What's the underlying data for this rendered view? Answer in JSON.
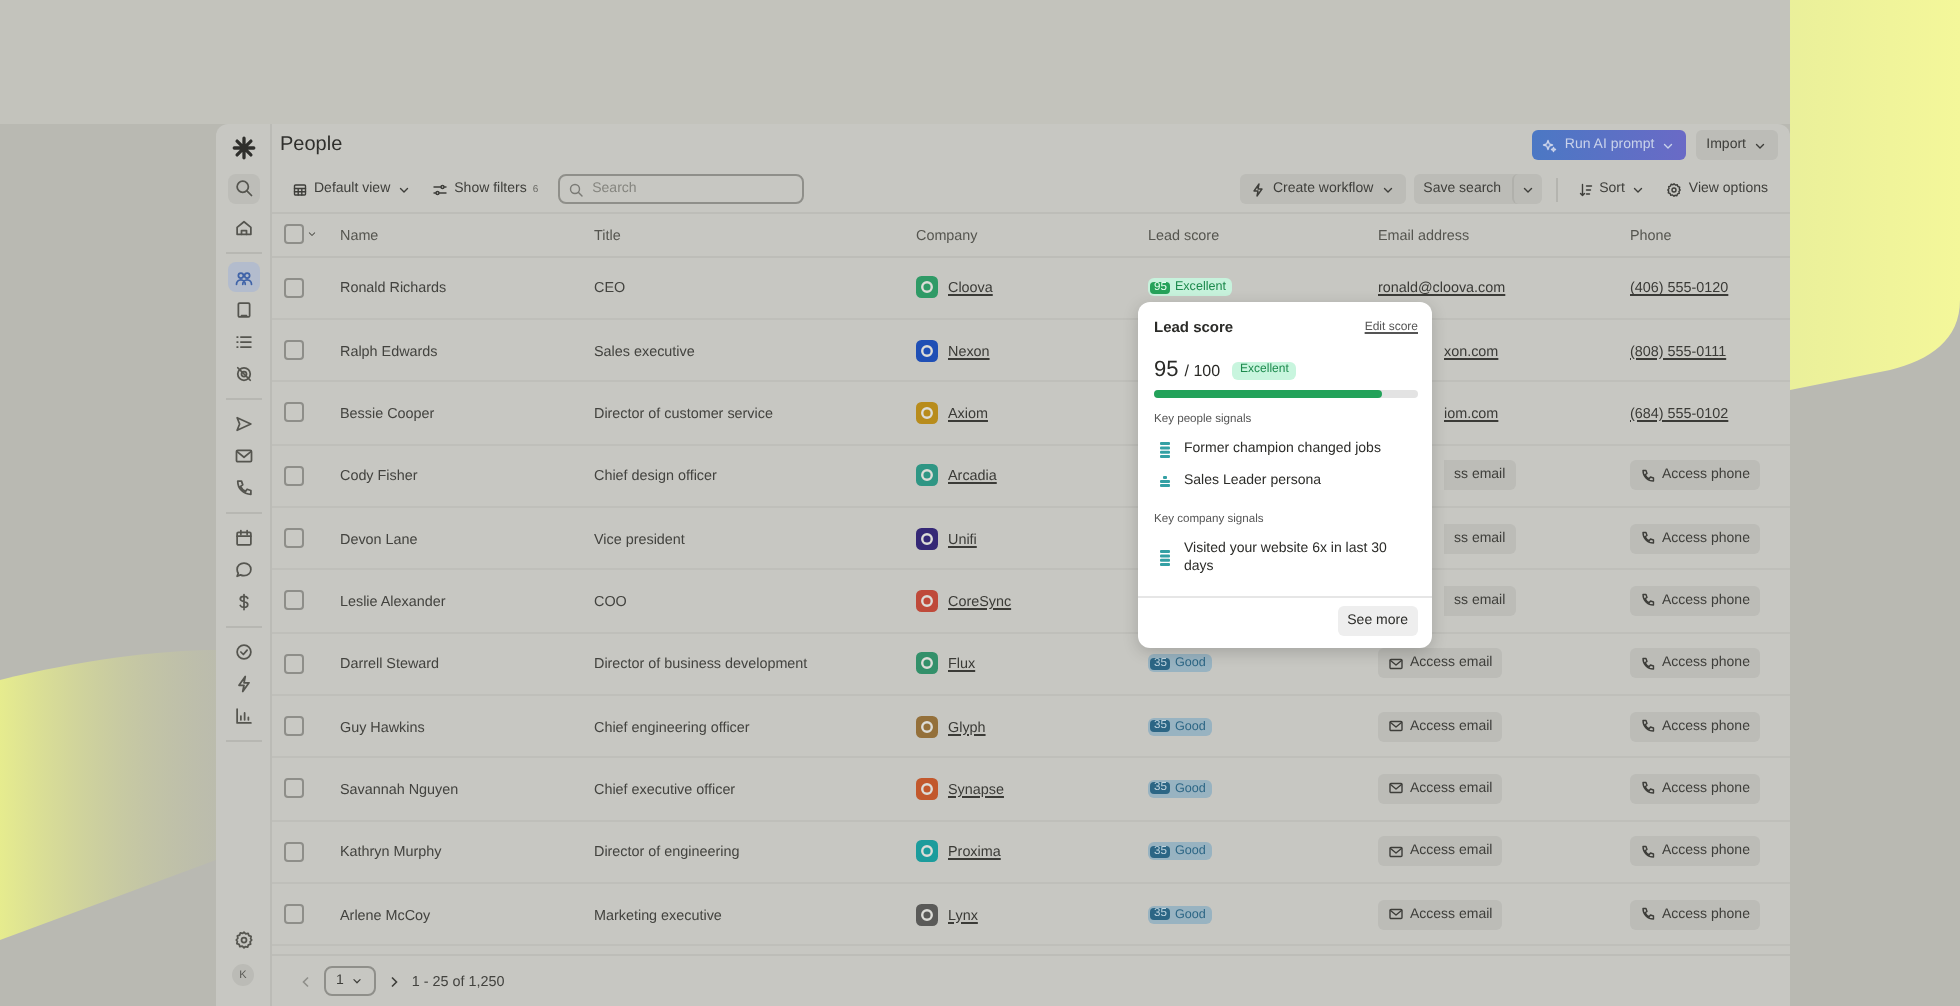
{
  "app": {
    "avatar": "K"
  },
  "sidebar": {
    "items": [
      {
        "selected": false
      },
      {
        "selected": false
      },
      {
        "selected": true
      },
      {
        "selected": false
      },
      {
        "selected": false
      },
      {
        "selected": false
      },
      {
        "selected": false
      },
      {
        "selected": false
      },
      {
        "selected": false
      },
      {
        "selected": false
      },
      {
        "selected": false
      },
      {
        "selected": false
      },
      {
        "selected": false
      },
      {
        "selected": false
      },
      {
        "selected": false
      },
      {
        "selected": false
      }
    ]
  },
  "header": {
    "title": "People",
    "buttons": [
      {
        "label": "Run AI prompt",
        "kind": "primary"
      },
      {
        "label": "Import",
        "kind": "secondary"
      }
    ]
  },
  "toolbar": {
    "view": "Default view",
    "filters": {
      "label": "Show filters",
      "count": "6"
    },
    "search": {
      "placeholder": "Search"
    },
    "workflow": "Create workflow",
    "save": "Save search",
    "sort": "Sort",
    "options": "View options"
  },
  "table": {
    "select_all": {
      "checked": false
    },
    "columns": [
      "Name",
      "Title",
      "Company",
      "Lead score",
      "Email address",
      "Phone"
    ],
    "rows": [
      {
        "selected": false,
        "name": "Ronald Richards",
        "title": "CEO",
        "company": {
          "name": "Cloova",
          "color": "#2f9a66"
        },
        "lead_score": {
          "score": "95",
          "label": "Excellent",
          "kind": "excellent"
        },
        "email": {
          "kind": "link",
          "text": "ronald@cloova.com"
        },
        "phone": {
          "kind": "link",
          "text": "(406) 555-0120"
        }
      },
      {
        "selected": false,
        "name": "Ralph Edwards",
        "title": "Sales executive",
        "company": {
          "name": "Nexon",
          "color": "#1f4fb5"
        },
        "email": {
          "kind": "link",
          "text": "xon.com",
          "partial": true
        },
        "phone": {
          "kind": "link",
          "text": "(808) 555-0111"
        }
      },
      {
        "selected": false,
        "name": "Bessie Cooper",
        "title": "Director of customer service",
        "company": {
          "name": "Axiom",
          "color": "#b88c1c"
        },
        "email": {
          "kind": "link",
          "text": "iom.com",
          "partial": true
        },
        "phone": {
          "kind": "link",
          "text": "(684) 555-0102"
        }
      },
      {
        "selected": false,
        "name": "Cody Fisher",
        "title": "Chief design officer",
        "company": {
          "name": "Arcadia",
          "color": "#2f9684"
        },
        "email": {
          "kind": "button",
          "text": "ss email",
          "partial": true
        },
        "phone": {
          "kind": "button",
          "text": "Access phone"
        }
      },
      {
        "selected": false,
        "name": "Devon Lane",
        "title": "Vice president",
        "company": {
          "name": "Unifi",
          "color": "#352876"
        },
        "email": {
          "kind": "button",
          "text": "ss email",
          "partial": true
        },
        "phone": {
          "kind": "button",
          "text": "Access phone"
        }
      },
      {
        "selected": false,
        "name": "Leslie Alexander",
        "title": "COO",
        "company": {
          "name": "CoreSync",
          "color": "#bf4a3a"
        },
        "email": {
          "kind": "button",
          "text": "ss email",
          "partial": true
        },
        "phone": {
          "kind": "button",
          "text": "Access phone"
        }
      },
      {
        "selected": false,
        "name": "Darrell Steward",
        "title": "Director of business development",
        "company": {
          "name": "Flux",
          "color": "#33906a"
        },
        "lead_score": {
          "score": "35",
          "label": "Good",
          "kind": "good"
        },
        "email": {
          "kind": "button",
          "text": "Access email"
        },
        "phone": {
          "kind": "button",
          "text": "Access phone"
        }
      },
      {
        "selected": false,
        "name": "Guy Hawkins",
        "title": "Chief engineering officer",
        "company": {
          "name": "Glyph",
          "color": "#94703a"
        },
        "lead_score": {
          "score": "35",
          "label": "Good",
          "kind": "good"
        },
        "email": {
          "kind": "button",
          "text": "Access email"
        },
        "phone": {
          "kind": "button",
          "text": "Access phone"
        }
      },
      {
        "selected": false,
        "name": "Savannah Nguyen",
        "title": "Chief executive officer",
        "company": {
          "name": "Synapse",
          "color": "#c2582c"
        },
        "lead_score": {
          "score": "35",
          "label": "Good",
          "kind": "good"
        },
        "email": {
          "kind": "button",
          "text": "Access email"
        },
        "phone": {
          "kind": "button",
          "text": "Access phone"
        }
      },
      {
        "selected": false,
        "name": "Kathryn Murphy",
        "title": "Director of engineering",
        "company": {
          "name": "Proxima",
          "color": "#1c9c9c"
        },
        "lead_score": {
          "score": "35",
          "label": "Good",
          "kind": "good"
        },
        "email": {
          "kind": "button",
          "text": "Access email"
        },
        "phone": {
          "kind": "button",
          "text": "Access phone"
        }
      },
      {
        "selected": false,
        "name": "Arlene McCoy",
        "title": "Marketing executive",
        "company": {
          "name": "Lynx",
          "color": "#5a5a58"
        },
        "lead_score": {
          "score": "35",
          "label": "Good",
          "kind": "good"
        },
        "email": {
          "kind": "button",
          "text": "Access email"
        },
        "phone": {
          "kind": "button",
          "text": "Access phone"
        }
      }
    ]
  },
  "pager": {
    "prev_disabled": true,
    "page": "1",
    "range": "1 - 25 of 1,250"
  },
  "popover": {
    "title": "Lead score",
    "edit": "Edit score",
    "score": "95",
    "total": "/ 100",
    "badge": "Excellent",
    "level": 0.86,
    "groups": [
      {
        "title": "Key people signals",
        "signals": [
          {
            "text": "Former champion changed jobs",
            "kind": "high"
          },
          {
            "text": "Sales Leader persona",
            "kind": "medium"
          }
        ]
      },
      {
        "title": "Key company signals",
        "signals": [
          {
            "text": "Visited your website 6x in last 30 days",
            "kind": "high"
          }
        ]
      }
    ],
    "button": "See more"
  }
}
